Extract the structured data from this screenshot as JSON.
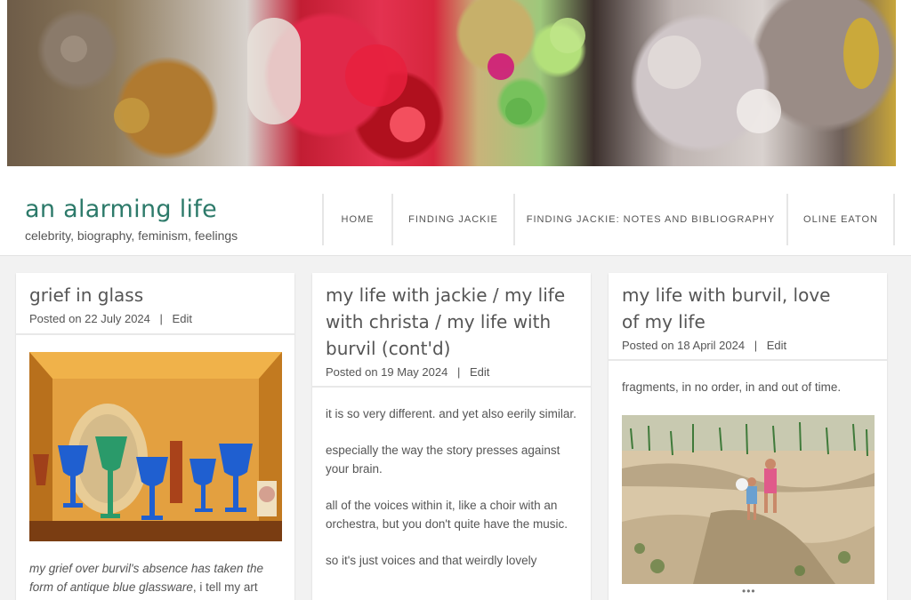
{
  "site": {
    "title": "an alarming life",
    "tagline": "celebrity, biography, feminism, feelings"
  },
  "nav": {
    "items": [
      "HOME",
      "FINDING JACKIE",
      "FINDING JACKIE: NOTES AND BIBLIOGRAPHY",
      "OLINE EATON"
    ]
  },
  "posts": [
    {
      "title": "grief in glass",
      "posted_prefix": "Posted on",
      "date": "22 July 2024",
      "separator": "|",
      "edit": "Edit",
      "excerpt_italic": "my grief over burvil's absence has taken the form of antique blue glassware",
      "excerpt_rest": ", i tell my art"
    },
    {
      "title": "my life with jackie / my life with christa / my life with burvil (cont'd)",
      "posted_prefix": "Posted on",
      "date": "19 May 2024",
      "separator": "|",
      "edit": "Edit",
      "paragraphs": [
        "it is so very different. and yet also eerily similar.",
        "especially the way the story presses against your brain.",
        "all of the voices within it, like a choir with an orchestra, but you don't quite have the music.",
        "so it's just voices and that weirdly lovely"
      ]
    },
    {
      "title": "my life with burvil, love of my life",
      "posted_prefix": "Posted on",
      "date": "18 April 2024",
      "separator": "|",
      "edit": "Edit",
      "intro": "fragments, in no order, in and out of time.",
      "more": "•••"
    }
  ]
}
